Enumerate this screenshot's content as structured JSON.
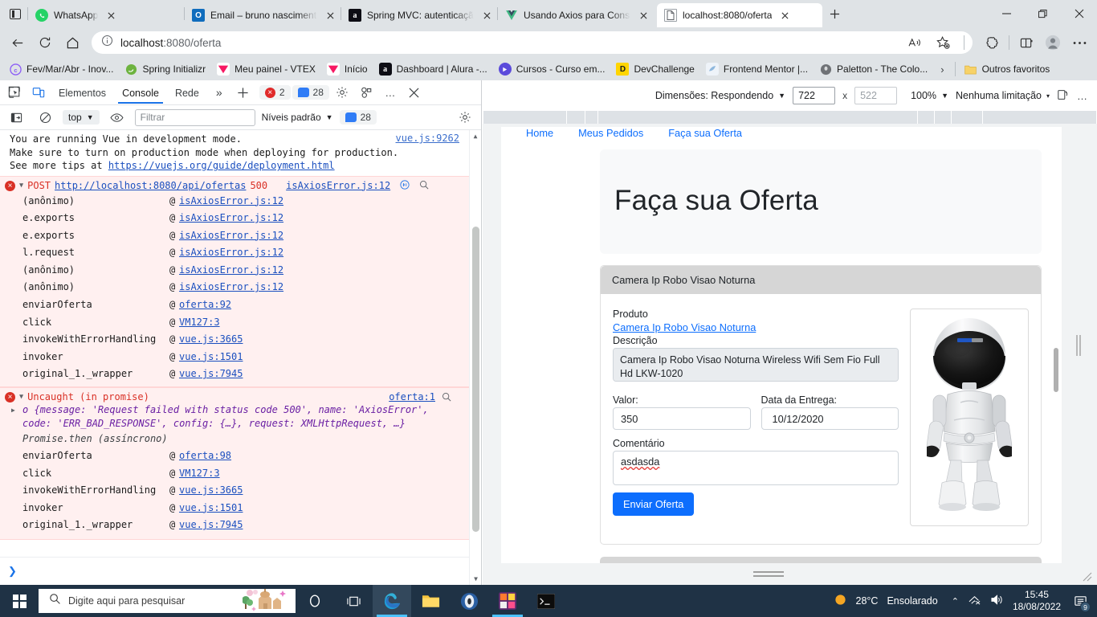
{
  "browser": {
    "tabs": [
      {
        "title": "WhatsApp",
        "icon": "whatsapp-icon",
        "active": false
      },
      {
        "title": "Email – bruno nascimento – O",
        "icon": "outlook-icon",
        "active": false
      },
      {
        "title": "Spring MVC: autenticação com",
        "icon": "alura-icon",
        "active": false
      },
      {
        "title": "Usando Axios para Consumir",
        "icon": "vue-icon",
        "active": false
      },
      {
        "title": "localhost:8080/oferta",
        "icon": "page-icon",
        "active": true
      }
    ],
    "window_controls": {
      "minimize": "–",
      "maximize": "❐",
      "close": "✕"
    },
    "address": {
      "host": "localhost",
      "rest": ":8080/oferta",
      "full": "localhost:8080/oferta"
    },
    "nav": {
      "back": "←",
      "refresh": "⟳",
      "home": "⌂",
      "read_aloud": "read-aloud-icon",
      "favorite": "add-favorite-icon",
      "collections": "collections-icon",
      "split": "split-screen-icon",
      "profile": "profile-icon",
      "more": "…"
    },
    "bookmarks": [
      {
        "label": "Fev/Mar/Abr - Inov...",
        "icon": "c-icon",
        "color": "#8b5cf6"
      },
      {
        "label": "Spring Initializr",
        "icon": "spring-icon",
        "color": "#6db33f"
      },
      {
        "label": "Meu painel - VTEX",
        "icon": "vtex-icon",
        "color": "#f71963"
      },
      {
        "label": "Início",
        "icon": "vtex-icon",
        "color": "#f71963"
      },
      {
        "label": "Dashboard | Alura -...",
        "icon": "alura-icon",
        "color": "#0d0d14"
      },
      {
        "label": "Cursos - Curso em...",
        "icon": "play-icon",
        "color": "#5b4bdb"
      },
      {
        "label": "DevChallenge",
        "icon": "d-icon",
        "color": "#ffd500"
      },
      {
        "label": "Frontend Mentor |...",
        "icon": "fem-icon",
        "color": "#e6eef8"
      },
      {
        "label": "Paletton - The Colo...",
        "icon": "paletton-icon",
        "color": "#6f7276"
      }
    ],
    "bookmarks_overflow": "›",
    "other_favorites": {
      "label": "Outros favoritos",
      "icon": "folder-icon"
    }
  },
  "devtools": {
    "tabs": [
      {
        "label": "Elementos",
        "selected": false
      },
      {
        "label": "Console",
        "selected": true
      },
      {
        "label": "Rede",
        "selected": false
      }
    ],
    "more_tabs": "»",
    "add_tab": "+",
    "error_count": "2",
    "info_count": "28",
    "settings_icon": "gear-icon",
    "customize_icon": "devtools-settings-icon",
    "more_icon": "…",
    "close_icon": "✕",
    "inspect_icon": "inspect-element-icon",
    "device_icon": "device-toolbar-icon",
    "filterbar": {
      "sidebar_icon": "console-sidebar-icon",
      "clear_icon": "clear-console-icon",
      "context": "top",
      "eye_icon": "live-expression-icon",
      "filter_placeholder": "Filtrar",
      "levels": "Níveis padrão",
      "message_count": "28",
      "settings_icon": "console-settings-icon"
    },
    "console": {
      "vue_warning": {
        "line1": "You are running Vue in development mode.",
        "line2": "Make sure to turn on production mode when deploying for production.",
        "line3_prefix": "See more tips at ",
        "line3_link": "https://vuejs.org/guide/deployment.html",
        "source": "vue.js:9262"
      },
      "post_error": {
        "method": "POST",
        "url": "http://localhost:8080/api/ofertas",
        "status": "500",
        "source": "isAxiosError.js:12",
        "network_icon": "network-request-icon",
        "search_icon": "search-icon",
        "stack": [
          {
            "fn": "(anônimo)",
            "at": "@",
            "link": "isAxiosError.js:12"
          },
          {
            "fn": "e.exports",
            "at": "@",
            "link": "isAxiosError.js:12"
          },
          {
            "fn": "e.exports",
            "at": "@",
            "link": "isAxiosError.js:12"
          },
          {
            "fn": "l.request",
            "at": "@",
            "link": "isAxiosError.js:12"
          },
          {
            "fn": "(anônimo)",
            "at": "@",
            "link": "isAxiosError.js:12"
          },
          {
            "fn": "(anônimo)",
            "at": "@",
            "link": "isAxiosError.js:12"
          },
          {
            "fn": "enviarOferta",
            "at": "@",
            "link": "oferta:92"
          },
          {
            "fn": "click",
            "at": "@",
            "link": "VM127:3"
          },
          {
            "fn": "invokeWithErrorHandling",
            "at": "@",
            "link": "vue.js:3665"
          },
          {
            "fn": "invoker",
            "at": "@",
            "link": "vue.js:1501"
          },
          {
            "fn": "original_1._wrapper",
            "at": "@",
            "link": "vue.js:7945"
          }
        ]
      },
      "uncaught_error": {
        "title": "Uncaught (in promise)",
        "source": "oferta:1",
        "search_icon": "search-icon",
        "object_line1": "o {message: 'Request failed with status code 500', name: 'AxiosError',",
        "object_line2": "code: 'ERR_BAD_RESPONSE', config: {…}, request: XMLHttpRequest, …}",
        "promise_note": "Promise.then (assíncrono)",
        "stack": [
          {
            "fn": "enviarOferta",
            "at": "@",
            "link": "oferta:98"
          },
          {
            "fn": "click",
            "at": "@",
            "link": "VM127:3"
          },
          {
            "fn": "invokeWithErrorHandling",
            "at": "@",
            "link": "vue.js:3665"
          },
          {
            "fn": "invoker",
            "at": "@",
            "link": "vue.js:1501"
          },
          {
            "fn": "original_1._wrapper",
            "at": "@",
            "link": "vue.js:7945"
          }
        ]
      },
      "prompt_chevron": "❯"
    }
  },
  "emulation": {
    "dimensions_label": "Dimensões: Respondendo",
    "width": "722",
    "height": "522",
    "zoom": "100%",
    "throttling": "Nenhuma limitação",
    "rotate_icon": "rotate-device-icon",
    "more_icon": "…"
  },
  "page": {
    "nav": [
      "Home",
      "Meus Pedidos",
      "Faça sua Oferta"
    ],
    "heading": "Faça sua Oferta",
    "card_title": "Camera Ip Robo Visao Noturna",
    "labels": {
      "produto": "Produto",
      "descricao": "Descrição",
      "valor": "Valor:",
      "data_entrega": "Data da Entrega:",
      "comentario": "Comentário"
    },
    "produto_link": "Camera Ip Robo Visao Noturna",
    "descricao_value": "Camera Ip Robo Visao Noturna Wireless Wifi Sem Fio Full Hd LKW-1020",
    "valor_value": "350",
    "data_entrega_value": "10/12/2020",
    "comentario_value": "asdasda",
    "submit_label": "Enviar Oferta",
    "product_image_alt": "white-robot-ip-camera-image",
    "accent_color": "#0d6efd"
  },
  "taskbar": {
    "search_placeholder": "Digite aqui para pesquisar",
    "start_icon": "windows-start-icon",
    "items": [
      {
        "name": "cortana-icon"
      },
      {
        "name": "task-view-icon"
      },
      {
        "name": "edge-icon"
      },
      {
        "name": "file-explorer-icon"
      },
      {
        "name": "media-player-icon"
      },
      {
        "name": "intellij-idea-icon"
      },
      {
        "name": "terminal-icon"
      }
    ],
    "weather": {
      "temp": "28°C",
      "condition": "Ensolarado",
      "icon": "sun-icon"
    },
    "tray": {
      "chevron": "⌃",
      "network_icon": "network-icon",
      "volume_icon": "volume-icon"
    },
    "time": "15:45",
    "date": "18/08/2022",
    "notifications": "9"
  }
}
